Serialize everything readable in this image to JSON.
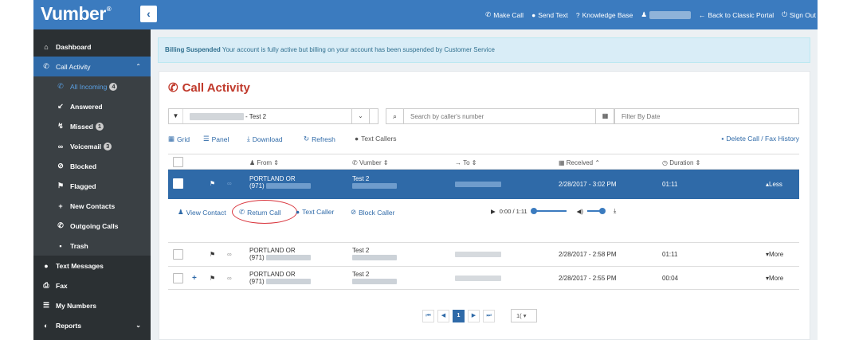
{
  "header": {
    "logo": "Vumber",
    "toggle_icon": "‹",
    "links": [
      {
        "icon": "phone-icon",
        "glyph": "✆",
        "label": "Make Call"
      },
      {
        "icon": "chat-icon",
        "glyph": "●",
        "label": "Send Text"
      },
      {
        "icon": "help-icon",
        "glyph": "?",
        "label": "Knowledge Base"
      },
      {
        "icon": "user-icon",
        "glyph": "♟",
        "label": ""
      },
      {
        "icon": "arrow-left-icon",
        "glyph": "←",
        "label": "Back to Classic Portal"
      },
      {
        "icon": "power-icon",
        "glyph": "⏻",
        "label": "Sign Out"
      }
    ]
  },
  "sidebar": {
    "items": [
      {
        "label": "Dashboard",
        "glyph": "⌂"
      },
      {
        "label": "Call Activity",
        "glyph": "✆",
        "chev": "⌃"
      },
      {
        "label": "All Incoming",
        "glyph": "✆",
        "badge": "4"
      },
      {
        "label": "Answered",
        "glyph": "↙"
      },
      {
        "label": "Missed",
        "glyph": "↯",
        "badge": "1"
      },
      {
        "label": "Voicemail",
        "glyph": "∞",
        "badge": "3"
      },
      {
        "label": "Blocked",
        "glyph": "⊘"
      },
      {
        "label": "Flagged",
        "glyph": "⚑"
      },
      {
        "label": "New Contacts",
        "glyph": "+"
      },
      {
        "label": "Outgoing Calls",
        "glyph": "✆"
      },
      {
        "label": "Trash",
        "glyph": "▪"
      },
      {
        "label": "Text Messages",
        "glyph": "●"
      },
      {
        "label": "Fax",
        "glyph": "⎙"
      },
      {
        "label": "My Numbers",
        "glyph": "☰"
      },
      {
        "label": "Reports",
        "glyph": "◐",
        "chev": "⌄"
      }
    ]
  },
  "alert": {
    "title": "Billing Suspended",
    "message": "Your account is fully active but billing on your account has been suspended by Customer Service"
  },
  "panel": {
    "title": "Call Activity",
    "filter_value": "- Test 2",
    "search_placeholder": "Search by caller's number",
    "date_placeholder": "Filter By Date"
  },
  "toolbar": {
    "grid": "Grid",
    "panel": "Panel",
    "download": "Download",
    "refresh": "Refresh",
    "text_callers": "Text Callers",
    "delete_history": "Delete Call / Fax History"
  },
  "table": {
    "headers": {
      "from": "From",
      "vumber": "Vumber",
      "to": "To",
      "received": "Received",
      "duration": "Duration"
    },
    "rows": [
      {
        "from_city": "PORTLAND OR",
        "from_area": "(971)",
        "vumber": "Test 2",
        "received": "2/28/2017 - 3:02 PM",
        "duration": "01:11",
        "toggle": "Less"
      },
      {
        "from_city": "PORTLAND OR",
        "from_area": "(971)",
        "vumber": "Test 2",
        "received": "2/28/2017 - 2:58 PM",
        "duration": "01:11",
        "toggle": "More"
      },
      {
        "from_city": "PORTLAND OR",
        "from_area": "(971)",
        "vumber": "Test 2",
        "received": "2/28/2017 - 2:55 PM",
        "duration": "00:04",
        "toggle": "More"
      }
    ]
  },
  "expanded_actions": {
    "view_contact": "View Contact",
    "return_call": "Return Call",
    "text_caller": "Text Caller",
    "block_caller": "Block Caller",
    "player_time": "0:00 / 1:11"
  },
  "pager": {
    "first": "⏮",
    "prev": "◀",
    "current": "1",
    "next": "▶",
    "last": "⏭",
    "page_size": "1("
  }
}
